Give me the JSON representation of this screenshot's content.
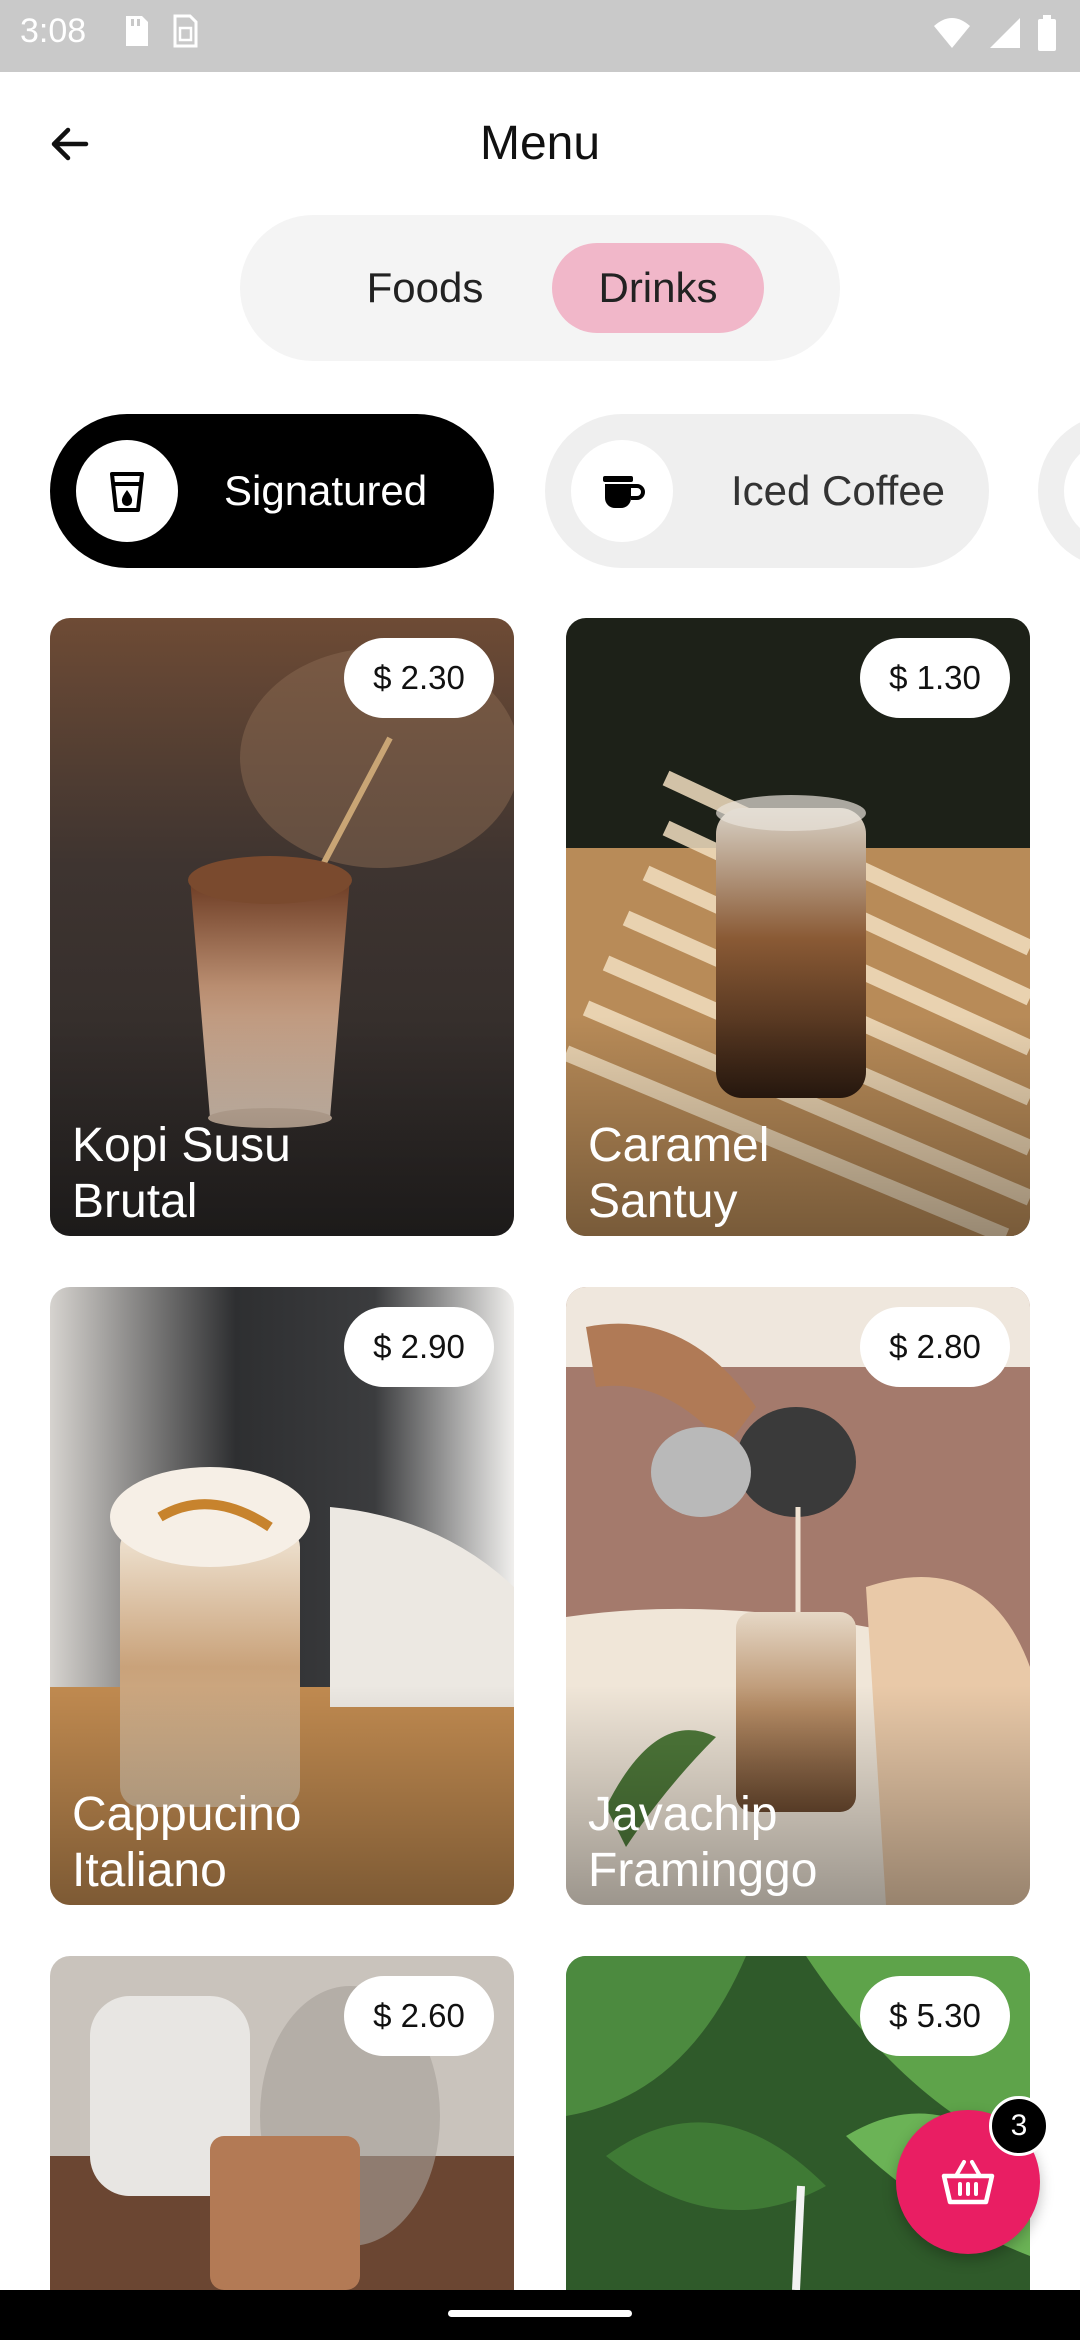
{
  "status_bar": {
    "time": "3:08",
    "icons_left": [
      "sd-card-icon",
      "sim-icon"
    ],
    "icons_right": [
      "wifi-icon",
      "signal-icon",
      "battery-icon"
    ]
  },
  "app_bar": {
    "back_icon": "arrow-left-icon",
    "title": "Menu"
  },
  "segmented": {
    "options": [
      "Foods",
      "Drinks"
    ],
    "selected": "Drinks",
    "selected_color": "#f1b7c9"
  },
  "categories": [
    {
      "label": "Signatured",
      "icon": "cup-drop-icon",
      "selected": true
    },
    {
      "label": "Iced Coffee",
      "icon": "coffee-mug-icon",
      "selected": false
    },
    {
      "label": "",
      "icon": "coffee-icon",
      "selected": false
    }
  ],
  "products": [
    {
      "name": "Kopi Susu Brutal",
      "price": "$ 2.30"
    },
    {
      "name": "Caramel Santuy",
      "price": "$ 1.30"
    },
    {
      "name": "Cappucino Italiano",
      "price": "$ 2.90"
    },
    {
      "name": "Javachip Framinggo",
      "price": "$ 2.80"
    },
    {
      "name": "",
      "price": "$ 2.60"
    },
    {
      "name": "",
      "price": "$ 5.30"
    }
  ],
  "cart": {
    "icon": "basket-icon",
    "count": "3",
    "color": "#e91e63"
  },
  "colors": {
    "accent": "#e91e63",
    "chip_selected": "#000000",
    "chip_unselected": "#efefef"
  }
}
